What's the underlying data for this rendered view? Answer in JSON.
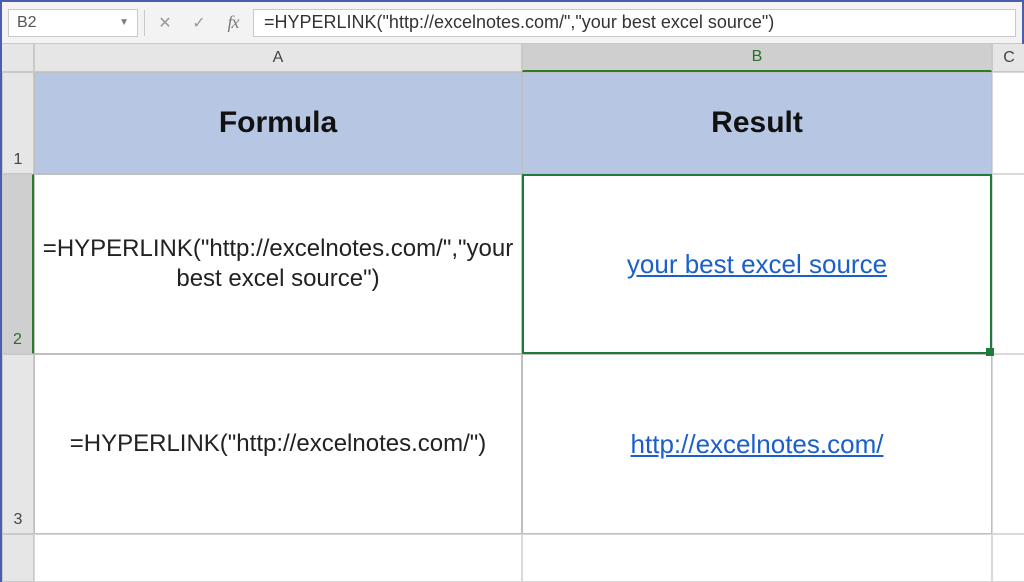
{
  "formula_bar": {
    "name_box": "B2",
    "formula": "=HYPERLINK(\"http://excelnotes.com/\",\"your best excel source\")"
  },
  "columns": {
    "A": "A",
    "B": "B",
    "C": "C"
  },
  "rows": {
    "r1": "1",
    "r2": "2",
    "r3": "3"
  },
  "headers": {
    "A": "Formula",
    "B": "Result"
  },
  "cells": {
    "A2": "=HYPERLINK(\"http://excelnotes.com/\",\"your best excel source\")",
    "B2": "your best excel source",
    "A3": "=HYPERLINK(\"http://excelnotes.com/\")",
    "B3": "http://excelnotes.com/"
  },
  "selected_cell": "B2"
}
